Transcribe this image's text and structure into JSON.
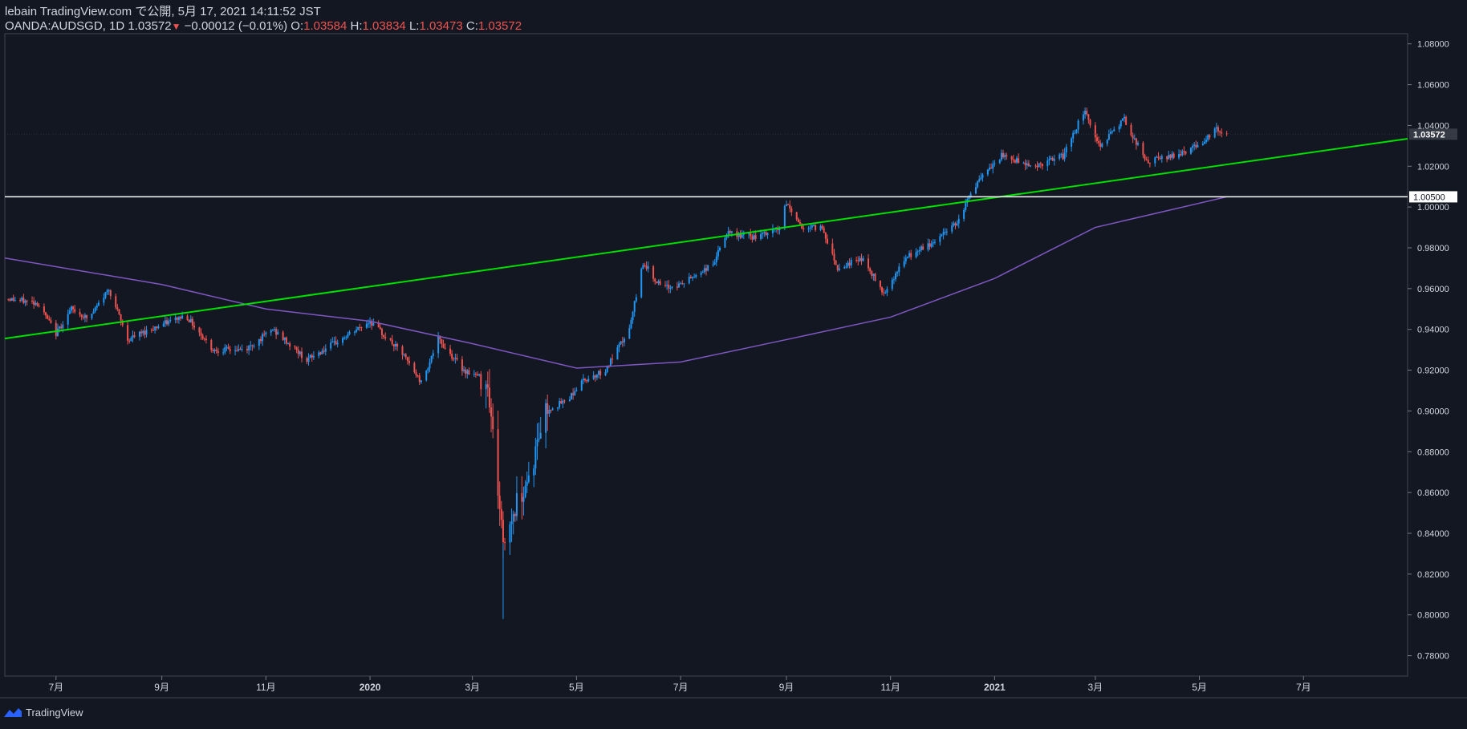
{
  "header": {
    "publisher": "lebain TradingView.com で公開, 5月 17, 2021 14:11:52 JST",
    "symbol": "OANDA:AUDSGD, 1D",
    "last": "1.03572",
    "change": "−0.00012 (−0.01%)",
    "o_label": "O:",
    "o": "1.03584",
    "h_label": "H:",
    "h": "1.03834",
    "l_label": "L:",
    "l": "1.03473",
    "c_label": "C:",
    "c": "1.03572"
  },
  "footer": {
    "brand": "TradingView"
  },
  "colors": {
    "background": "#131722",
    "up": "#2196f3",
    "down": "#ef5350",
    "trendline": "#00e000",
    "moving_average": "#7e57c2",
    "horizontal_line": "#ffffff"
  },
  "chart_data": {
    "type": "candlestick",
    "symbol": "OANDA:AUDSGD",
    "interval": "1D",
    "ylim": [
      0.77,
      1.085
    ],
    "y_ticks": [
      "1.08000",
      "1.06000",
      "1.04000",
      "1.02000",
      "1.00000",
      "0.98000",
      "0.96000",
      "0.94000",
      "0.92000",
      "0.90000",
      "0.88000",
      "0.86000",
      "0.84000",
      "0.82000",
      "0.80000",
      "0.78000"
    ],
    "y_tick_values": [
      1.08,
      1.06,
      1.04,
      1.02,
      1.0,
      0.98,
      0.96,
      0.94,
      0.92,
      0.9,
      0.88,
      0.86,
      0.84,
      0.82,
      0.8,
      0.78
    ],
    "x_range": [
      "2019-06-01",
      "2021-08-31"
    ],
    "x_ticks": [
      {
        "label": "7月",
        "date": "2019-07-01"
      },
      {
        "label": "9月",
        "date": "2019-09-01"
      },
      {
        "label": "11月",
        "date": "2019-11-01"
      },
      {
        "label": "2020",
        "date": "2020-01-01"
      },
      {
        "label": "3月",
        "date": "2020-03-01"
      },
      {
        "label": "5月",
        "date": "2020-05-01"
      },
      {
        "label": "7月",
        "date": "2020-07-01"
      },
      {
        "label": "9月",
        "date": "2020-09-01"
      },
      {
        "label": "11月",
        "date": "2020-11-01"
      },
      {
        "label": "2021",
        "date": "2021-01-01"
      },
      {
        "label": "3月",
        "date": "2021-03-01"
      },
      {
        "label": "5月",
        "date": "2021-05-01"
      },
      {
        "label": "7月",
        "date": "2021-07-01"
      }
    ],
    "price_path": [
      [
        "2019-06-03",
        0.955
      ],
      [
        "2019-06-20",
        0.953
      ],
      [
        "2019-07-01",
        0.938
      ],
      [
        "2019-07-10",
        0.95
      ],
      [
        "2019-07-20",
        0.945
      ],
      [
        "2019-08-01",
        0.96
      ],
      [
        "2019-08-12",
        0.935
      ],
      [
        "2019-08-25",
        0.94
      ],
      [
        "2019-09-15",
        0.947
      ],
      [
        "2019-10-01",
        0.93
      ],
      [
        "2019-10-20",
        0.93
      ],
      [
        "2019-11-05",
        0.94
      ],
      [
        "2019-11-25",
        0.925
      ],
      [
        "2019-12-15",
        0.935
      ],
      [
        "2020-01-01",
        0.944
      ],
      [
        "2020-01-20",
        0.928
      ],
      [
        "2020-01-31",
        0.914
      ],
      [
        "2020-02-10",
        0.935
      ],
      [
        "2020-02-25",
        0.92
      ],
      [
        "2020-03-10",
        0.915
      ],
      [
        "2020-03-19",
        0.835
      ],
      [
        "2020-03-27",
        0.855
      ],
      [
        "2020-04-05",
        0.872
      ],
      [
        "2020-04-12",
        0.9
      ],
      [
        "2020-04-25",
        0.905
      ],
      [
        "2020-05-05",
        0.915
      ],
      [
        "2020-05-18",
        0.92
      ],
      [
        "2020-06-01",
        0.94
      ],
      [
        "2020-06-09",
        0.973
      ],
      [
        "2020-06-20",
        0.96
      ],
      [
        "2020-07-01",
        0.962
      ],
      [
        "2020-07-20",
        0.972
      ],
      [
        "2020-07-28",
        0.987
      ],
      [
        "2020-08-15",
        0.985
      ],
      [
        "2020-08-28",
        0.99
      ],
      [
        "2020-09-01",
        1.002
      ],
      [
        "2020-09-10",
        0.99
      ],
      [
        "2020-09-22",
        0.99
      ],
      [
        "2020-10-01",
        0.97
      ],
      [
        "2020-10-15",
        0.975
      ],
      [
        "2020-10-28",
        0.958
      ],
      [
        "2020-11-10",
        0.975
      ],
      [
        "2020-11-25",
        0.982
      ],
      [
        "2020-12-10",
        0.993
      ],
      [
        "2020-12-20",
        1.01
      ],
      [
        "2021-01-05",
        1.025
      ],
      [
        "2021-01-25",
        1.02
      ],
      [
        "2021-02-10",
        1.025
      ],
      [
        "2021-02-23",
        1.048
      ],
      [
        "2021-03-03",
        1.03
      ],
      [
        "2021-03-18",
        1.043
      ],
      [
        "2021-03-31",
        1.022
      ],
      [
        "2021-04-15",
        1.025
      ],
      [
        "2021-04-30",
        1.03
      ],
      [
        "2021-05-10",
        1.038
      ],
      [
        "2021-05-17",
        1.0357
      ]
    ],
    "annotations": {
      "trendline": [
        [
          "2019-06-01",
          0.9355
        ],
        [
          "2021-08-31",
          1.0335
        ]
      ],
      "horizontal_line": {
        "value": 1.005,
        "label": "1.00500"
      },
      "last_price": {
        "value": 1.03572,
        "label": "1.03572"
      },
      "moving_average": [
        [
          "2019-06-01",
          0.975
        ],
        [
          "2019-09-01",
          0.962
        ],
        [
          "2019-11-01",
          0.95
        ],
        [
          "2020-01-01",
          0.944
        ],
        [
          "2020-03-01",
          0.933
        ],
        [
          "2020-05-01",
          0.921
        ],
        [
          "2020-07-01",
          0.924
        ],
        [
          "2020-09-01",
          0.935
        ],
        [
          "2020-11-01",
          0.946
        ],
        [
          "2021-01-01",
          0.965
        ],
        [
          "2021-03-01",
          0.99
        ],
        [
          "2021-05-17",
          1.005
        ]
      ]
    }
  }
}
